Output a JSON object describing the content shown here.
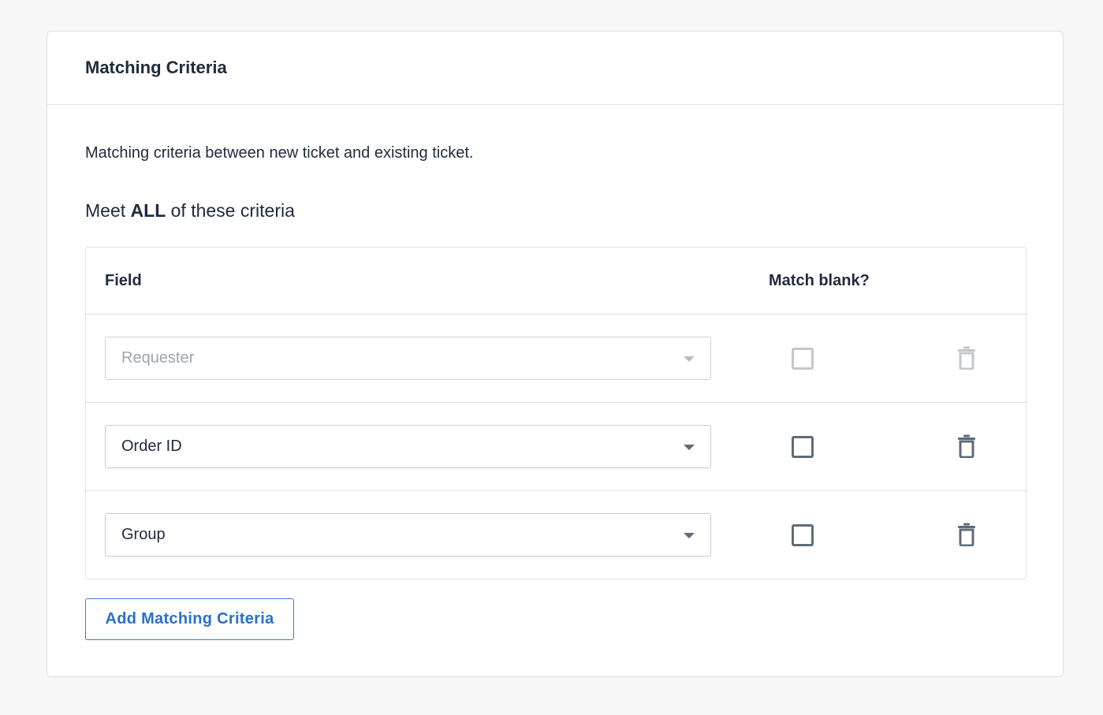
{
  "card": {
    "title": "Matching Criteria",
    "description": "Matching criteria between new ticket and existing ticket.",
    "meet_prefix": "Meet",
    "meet_emphasis": "ALL",
    "meet_suffix": "of these criteria"
  },
  "table": {
    "columns": {
      "field": "Field",
      "match_blank": "Match blank?"
    },
    "rows": [
      {
        "field_value": "Requester",
        "disabled": true,
        "match_blank_checked": false
      },
      {
        "field_value": "Order ID",
        "disabled": false,
        "match_blank_checked": false
      },
      {
        "field_value": "Group",
        "disabled": false,
        "match_blank_checked": false
      }
    ]
  },
  "actions": {
    "add_label": "Add Matching Criteria"
  },
  "icons": {
    "dropdown": "chevron-down-icon",
    "delete": "trash-icon",
    "checkbox": "checkbox-icon"
  },
  "colors": {
    "accent": "#2a6fc9",
    "icon": "#5f6b7a",
    "icon_disabled": "#c3c7cd",
    "text": "#1f2a3d",
    "placeholder": "#9ea5ae"
  }
}
